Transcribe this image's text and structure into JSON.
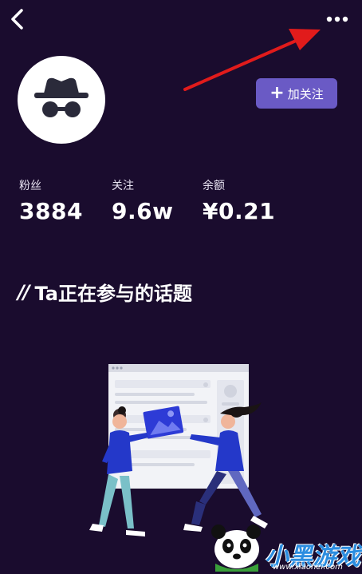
{
  "header": {
    "back_icon": "chevron-left-icon",
    "more_icon": "more-horizontal-icon"
  },
  "profile": {
    "avatar_icon": "incognito-icon",
    "follow_button": {
      "plus": "+",
      "label": "加关注"
    }
  },
  "stats": [
    {
      "label": "粉丝",
      "value": "3884"
    },
    {
      "label": "关注",
      "value": "9.6w"
    },
    {
      "label": "余额",
      "value": "¥0.21"
    }
  ],
  "section": {
    "mark": "//",
    "title": "Ta正在参与的话题"
  },
  "watermark": {
    "text": "小黑游戏",
    "url": "www.xiaohei.com"
  },
  "colors": {
    "background": "#1a0c2e",
    "accent": "#6a5ac5",
    "annotation_arrow": "#e11b1b"
  }
}
